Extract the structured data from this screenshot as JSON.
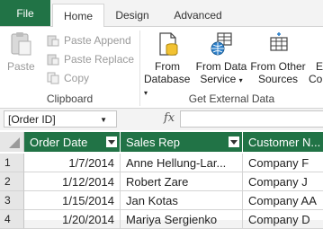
{
  "tabs": {
    "file": "File",
    "home": "Home",
    "design": "Design",
    "advanced": "Advanced"
  },
  "clipboard": {
    "paste": "Paste",
    "paste_append": "Paste Append",
    "paste_replace": "Paste Replace",
    "copy": "Copy",
    "group_label": "Clipboard"
  },
  "external": {
    "from_database_1": "From",
    "from_database_2": "Database",
    "from_data_service_1": "From Data",
    "from_data_service_2": "Service",
    "from_other_sources_1": "From Other",
    "from_other_sources_2": "Sources",
    "existing_1": "E",
    "existing_2": "Co",
    "group_label": "Get External Data"
  },
  "formula_bar": {
    "name_box": "[Order ID]",
    "fx": "fx"
  },
  "colors": {
    "accent": "#217346",
    "ribbon_bg": "#ffffff",
    "disabled": "#9a9a9a"
  },
  "table": {
    "columns": [
      "Order Date",
      "Sales Rep",
      "Customer N..."
    ],
    "rows": [
      {
        "num": "1",
        "cells": [
          "1/7/2014",
          "Anne Hellung-Lar...",
          "Company F"
        ]
      },
      {
        "num": "2",
        "cells": [
          "1/12/2014",
          "Robert Zare",
          "Company J"
        ]
      },
      {
        "num": "3",
        "cells": [
          "1/15/2014",
          "Jan Kotas",
          "Company AA"
        ]
      },
      {
        "num": "4",
        "cells": [
          "1/20/2014",
          "Mariya Sergienko",
          "Company D"
        ]
      }
    ]
  }
}
